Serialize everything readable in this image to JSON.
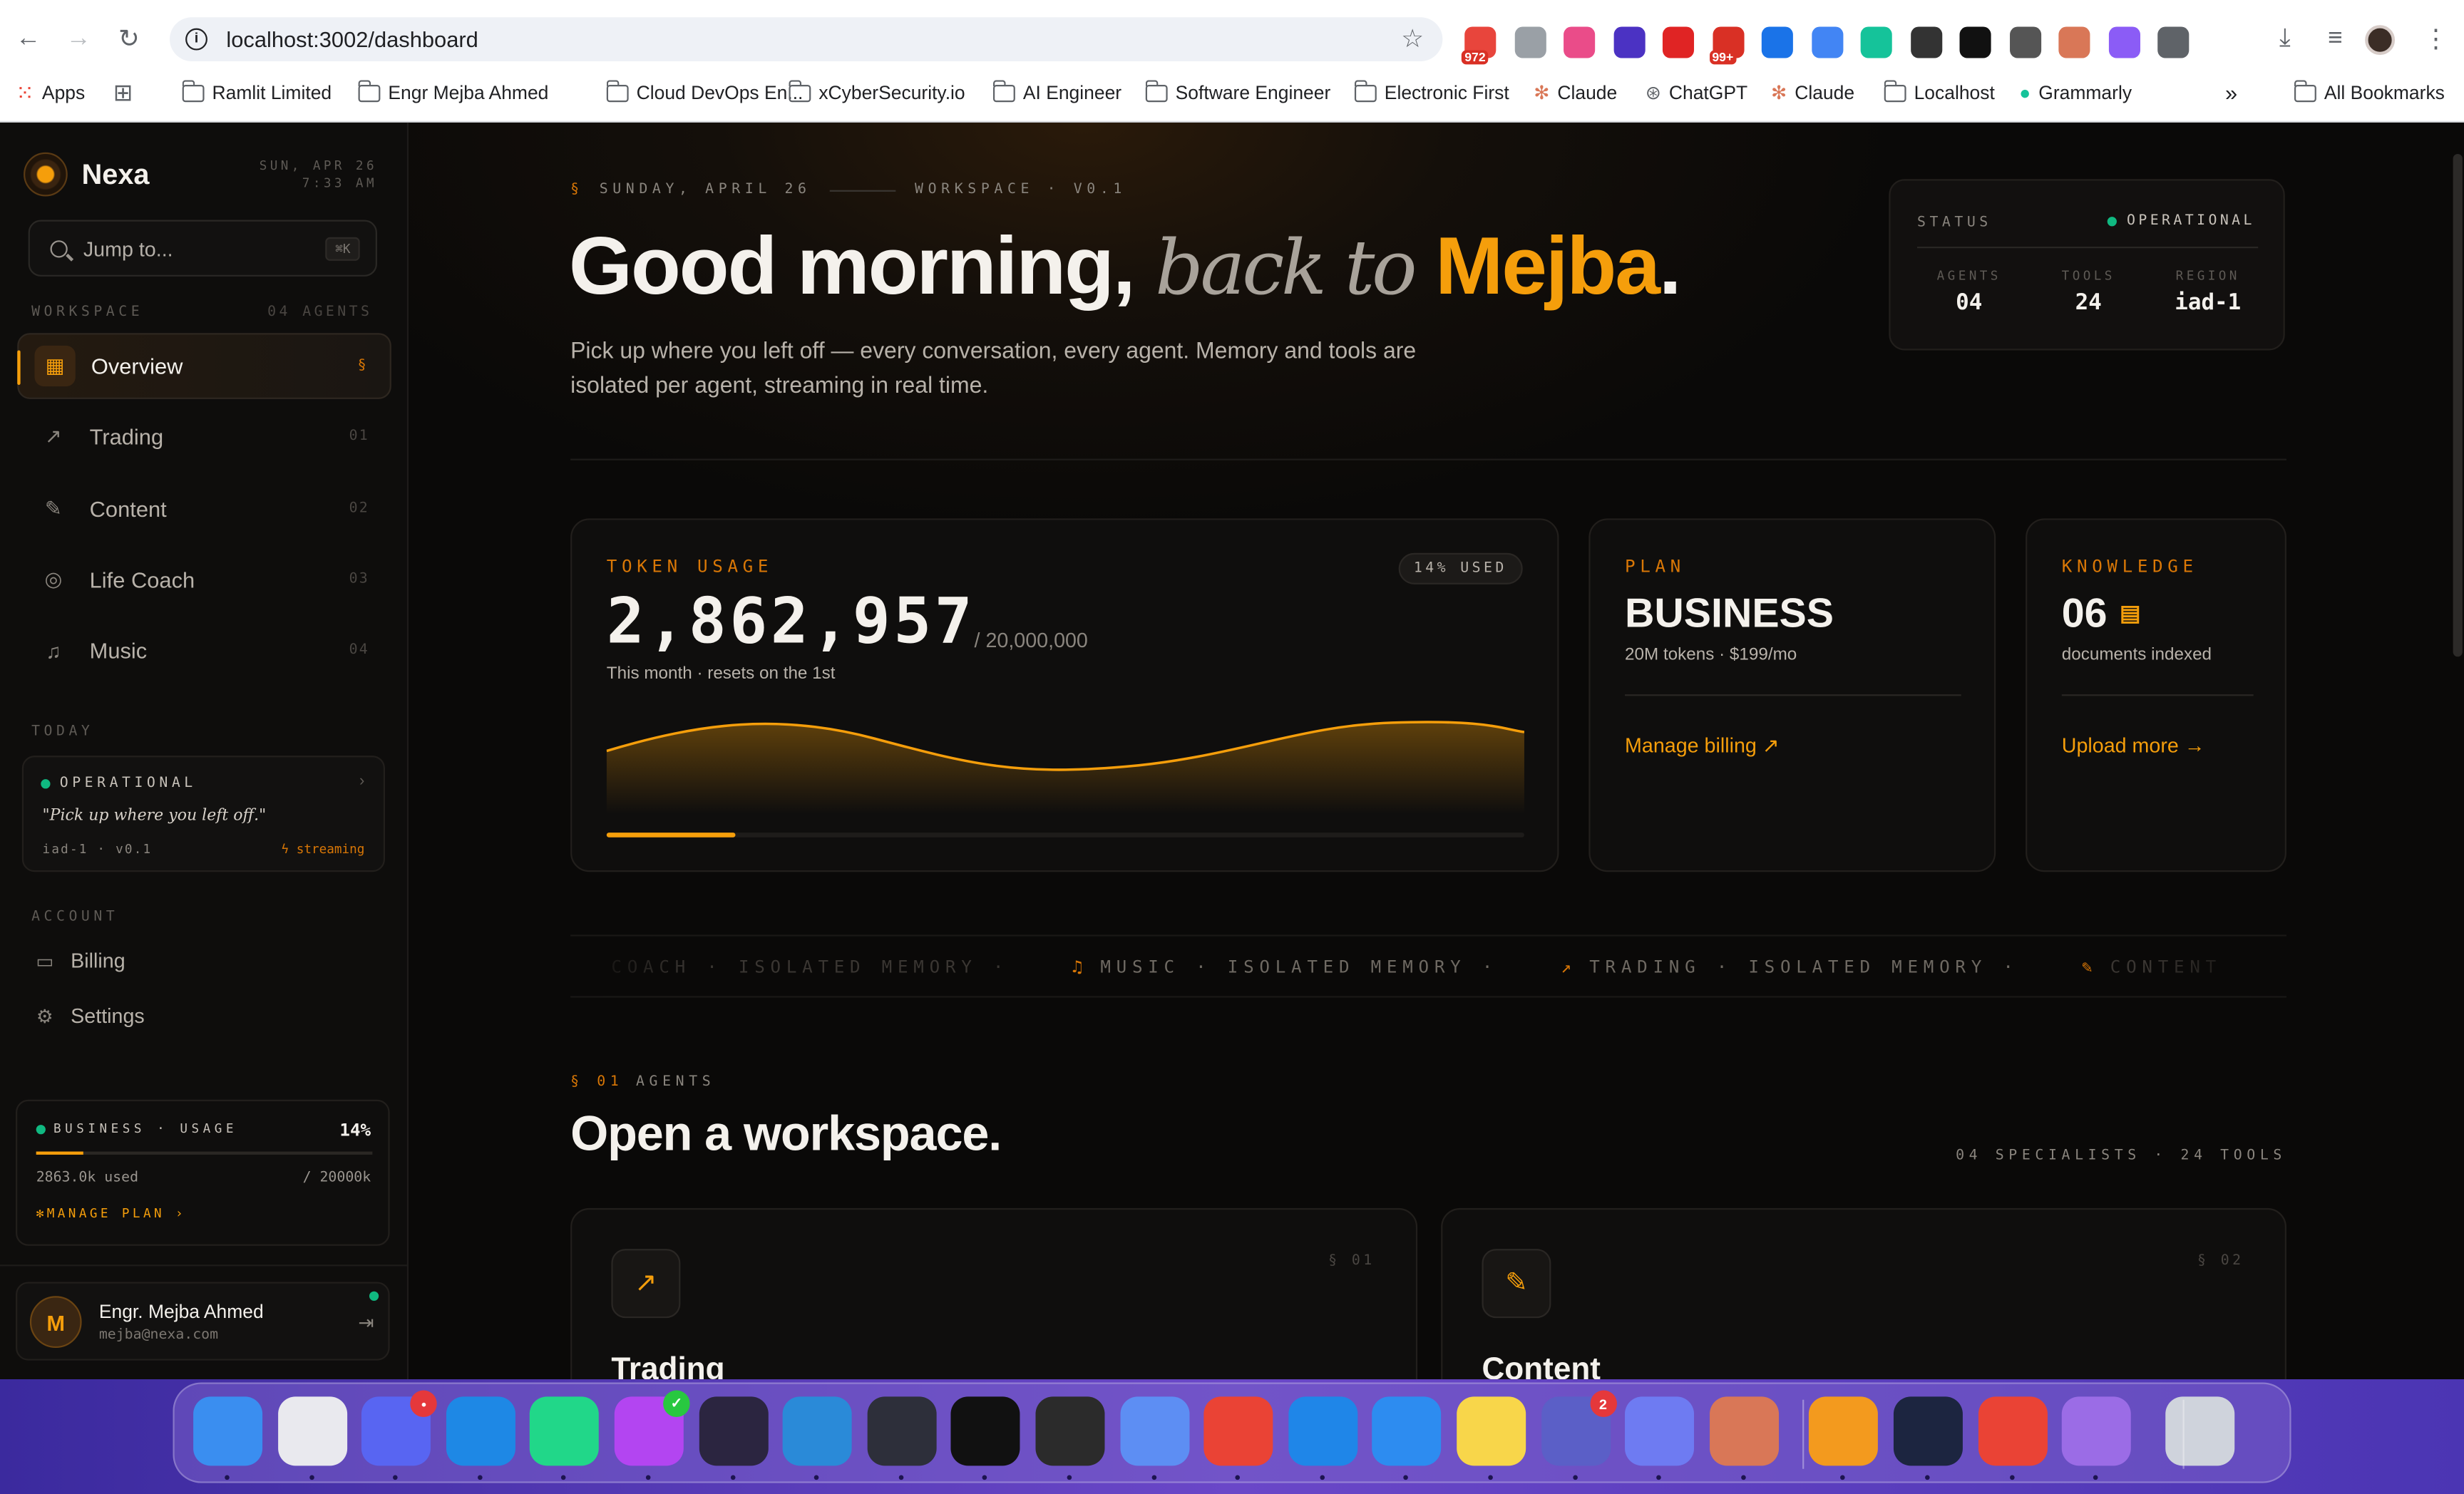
{
  "browser": {
    "url": "localhost:3002/dashboard",
    "extensions": [
      {
        "name": "calendar-ext-icon",
        "badge": "972",
        "color": "#e8453c"
      },
      {
        "name": "camera-ext-icon",
        "badge": "",
        "color": "#9aa0a6"
      },
      {
        "name": "play-ext-icon",
        "badge": "",
        "color": "#ea4c89"
      },
      {
        "name": "diamond-ext-icon",
        "badge": "",
        "color": "#4b32c3"
      },
      {
        "name": "shield-ext-icon",
        "badge": "",
        "color": "#e02424"
      },
      {
        "name": "mail-ext-icon",
        "badge": "99+",
        "color": "#d93025"
      },
      {
        "name": "tag-ext-icon",
        "badge": "",
        "color": "#1a73e8"
      },
      {
        "name": "broadcast-ext-icon",
        "badge": "",
        "color": "#4285f4"
      },
      {
        "name": "grammar-ext-icon",
        "badge": "",
        "color": "#15c39a"
      },
      {
        "name": "ubiquiti-ext-icon",
        "badge": "",
        "color": "#333333"
      },
      {
        "name": "openai-ext-icon",
        "badge": "",
        "color": "#111111"
      },
      {
        "name": "feather-ext-icon",
        "badge": "",
        "color": "#555555"
      },
      {
        "name": "claude-ext-icon",
        "badge": "",
        "color": "#d97757"
      },
      {
        "name": "crystal-ext-icon",
        "badge": "",
        "color": "#8b5cf6"
      },
      {
        "name": "puzzle-ext-icon",
        "badge": "",
        "color": "#5f6368"
      }
    ],
    "bookmarks": [
      {
        "label": "Apps",
        "icon": "apps-grid-icon"
      },
      {
        "label": "",
        "icon": "tab-grid-icon"
      },
      {
        "label": "Ramlit Limited",
        "icon": "folder-icon"
      },
      {
        "label": "Engr Mejba Ahmed",
        "icon": "folder-icon"
      },
      {
        "label": "Cloud DevOps En...",
        "icon": "folder-icon"
      },
      {
        "label": "xCyberSecurity.io",
        "icon": "folder-icon"
      },
      {
        "label": "AI Engineer",
        "icon": "folder-icon"
      },
      {
        "label": "Software Engineer",
        "icon": "folder-icon"
      },
      {
        "label": "Electronic First",
        "icon": "folder-icon"
      },
      {
        "label": "Claude",
        "icon": "claude-icon"
      },
      {
        "label": "ChatGPT",
        "icon": "chatgpt-icon"
      },
      {
        "label": "Claude",
        "icon": "claude-icon"
      },
      {
        "label": "Localhost",
        "icon": "folder-icon"
      },
      {
        "label": "Grammarly",
        "icon": "grammarly-icon"
      }
    ],
    "all_bookmarks": "All Bookmarks",
    "more": "»"
  },
  "sidebar": {
    "brand": "Nexa",
    "date_line": "SUN, APR 26",
    "time_line": "7:33 AM",
    "search_placeholder": "Jump to...",
    "search_shortcut": "⌘K",
    "workspace_label": "WORKSPACE",
    "workspace_count": "04 AGENTS",
    "nav": [
      {
        "label": "Overview",
        "num": "§",
        "icon": "grid-icon",
        "glyph": "▦",
        "active": true
      },
      {
        "label": "Trading",
        "num": "01",
        "icon": "trending-up-icon",
        "glyph": "↗",
        "active": false
      },
      {
        "label": "Content",
        "num": "02",
        "icon": "pen-tool-icon",
        "glyph": "✎",
        "active": false
      },
      {
        "label": "Life Coach",
        "num": "03",
        "icon": "compass-icon",
        "glyph": "◎",
        "active": false
      },
      {
        "label": "Music",
        "num": "04",
        "icon": "music-note-icon",
        "glyph": "♫",
        "active": false
      }
    ],
    "today_label": "TODAY",
    "today": {
      "status": "OPERATIONAL",
      "quote": "\"Pick up where you left off.\"",
      "meta": "iad-1 · v0.1",
      "streaming": "streaming"
    },
    "account_label": "ACCOUNT",
    "account": [
      {
        "label": "Billing",
        "icon": "wallet-icon",
        "glyph": "▭"
      },
      {
        "label": "Settings",
        "icon": "gear-icon",
        "glyph": "⚙"
      }
    ],
    "usage": {
      "label": "BUSINESS · USAGE",
      "percent_label": "14%",
      "fraction": 0.14,
      "used": "2863.0k used",
      "total": "/ 20000k",
      "manage": "MANAGE PLAN ›"
    },
    "user": {
      "initial": "M",
      "name": "Engr. Mejba Ahmed",
      "email": "mejba@nexa.com"
    }
  },
  "main": {
    "kicker_date": "SUNDAY, APRIL 26",
    "kicker_ws": "WORKSPACE · V0.1",
    "greeting": "Good morning,",
    "greeting_italic": "back to",
    "greeting_name": "Mejba",
    "greeting_end": ".",
    "subtitle": "Pick up where you left off — every conversation, every agent. Memory and tools are isolated per agent, streaming in real time.",
    "status": {
      "label": "STATUS",
      "value": "OPERATIONAL",
      "stats": [
        {
          "k": "AGENTS",
          "v": "04"
        },
        {
          "k": "TOOLS",
          "v": "24"
        },
        {
          "k": "REGION",
          "v": "iad-1"
        }
      ]
    },
    "token": {
      "label": "TOKEN USAGE",
      "pill": "14% USED",
      "value": "2,862,957",
      "of": "/ 20,000,000",
      "note": "This month · resets on the 1st",
      "fraction": 0.14
    },
    "plan": {
      "label": "PLAN",
      "title": "BUSINESS",
      "desc": "20M tokens · $199/mo",
      "link": "Manage billing ↗"
    },
    "knowledge": {
      "label": "KNOWLEDGE",
      "title": "06",
      "desc": "documents indexed",
      "link": "Upload more →"
    },
    "ticker": [
      {
        "text": "COACH · ISOLATED MEMORY ·",
        "icon": "",
        "tone": "dim"
      },
      {
        "text": "MUSIC · ISOLATED MEMORY ·",
        "icon": "♫",
        "tone": "mid"
      },
      {
        "text": "TRADING · ISOLATED MEMORY ·",
        "icon": "↗",
        "tone": "mid"
      },
      {
        "text": "CONTENT",
        "icon": "✎",
        "tone": "dim"
      }
    ],
    "agents_kicker_num": "§ 01",
    "agents_kicker": "AGENTS",
    "agents_title": "Open a workspace.",
    "agents_meta": "04 SPECIALISTS · 24 TOOLS",
    "agents": [
      {
        "name": "Trading",
        "num": "§ 01",
        "glyph": "↗"
      },
      {
        "name": "Content",
        "num": "§ 02",
        "glyph": "✎"
      }
    ]
  },
  "colors": {
    "accent": "#f59e0b",
    "ok": "#10b981",
    "bg": "#0a0908"
  },
  "dock": [
    {
      "name": "finder-icon",
      "color": "#3a8ef0"
    },
    {
      "name": "launchpad-icon",
      "color": "#e9e9ee"
    },
    {
      "name": "discord-icon",
      "color": "#5865f2",
      "badge": "•"
    },
    {
      "name": "safari-icon",
      "color": "#1e88e5"
    },
    {
      "name": "pycharm-icon",
      "color": "#21d789"
    },
    {
      "name": "phpstorm-icon",
      "color": "#b345f1",
      "badge": "✓"
    },
    {
      "name": "obsidian-icon",
      "color": "#2b2540"
    },
    {
      "name": "vscode-icon",
      "color": "#2a8ad8"
    },
    {
      "name": "arc-icon",
      "color": "#2d2f3a"
    },
    {
      "name": "intellij-icon",
      "color": "#111111"
    },
    {
      "name": "cube-app-icon",
      "color": "#2b2b2b"
    },
    {
      "name": "terminal-chat-icon",
      "color": "#5d8ef3"
    },
    {
      "name": "chrome-icon",
      "color": "#ea4335"
    },
    {
      "name": "quicktime-icon",
      "color": "#1f86e8"
    },
    {
      "name": "appstore-icon",
      "color": "#2d8cf0"
    },
    {
      "name": "notes-icon",
      "color": "#f8d64a"
    },
    {
      "name": "teams-icon",
      "color": "#5b5fc7",
      "badge": "2"
    },
    {
      "name": "simulator-icon",
      "color": "#6e7bf2"
    },
    {
      "name": "claude-app-icon",
      "color": "#d97757"
    },
    {
      "name": "pages-icon",
      "color": "#f39a1e"
    },
    {
      "name": "xcode-console-icon",
      "color": "#1c2540"
    },
    {
      "name": "chrome-2-icon",
      "color": "#ea4335"
    },
    {
      "name": "siri-icon",
      "color": "#9b6ce6"
    },
    {
      "name": "trash-icon",
      "color": "#cfd3dc"
    }
  ]
}
